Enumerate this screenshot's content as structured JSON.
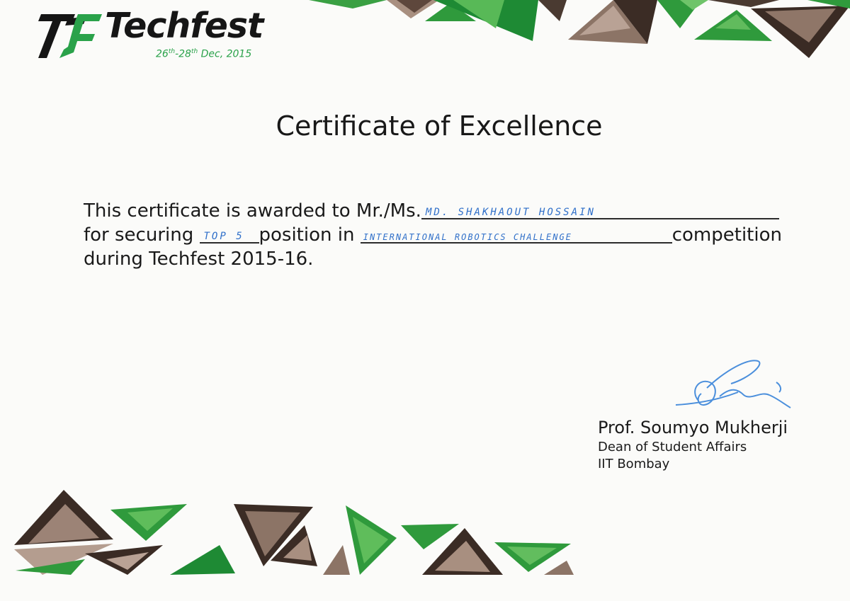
{
  "logo": {
    "brand": "Techfest",
    "dates_day1": "26",
    "dates_sup1": "th",
    "dates_mid": "-28",
    "dates_sup2": "th",
    "dates_tail": " Dec, 2015"
  },
  "certificate": {
    "title": "Certificate of Excellence",
    "line1_prefix": "This certificate is awarded to Mr./Ms.",
    "recipient_name": "MD. SHAKHAOUT HOSSAIN",
    "line2_prefix": "for securing",
    "position": "TOP 5",
    "line2_middle": "position in",
    "competition": "INTERNATIONAL ROBOTICS CHALLENGE",
    "line2_suffix": "competition",
    "line3": "during Techfest 2015-16."
  },
  "signatory": {
    "name": "Prof. Soumyo Mukherji",
    "role": "Dean of Student Affairs",
    "organization": "IIT Bombay"
  },
  "colors": {
    "green": "#2f9a3c",
    "dark_brown": "#3b2c25",
    "taupe": "#8c7466",
    "ink_blue": "#2f6fc9"
  }
}
